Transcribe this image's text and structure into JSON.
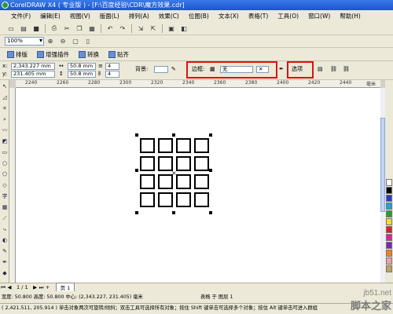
{
  "window": {
    "title": "CorelDRAW X4 ( 专业版 ) - [F:\\百度经验\\CDR\\魔方效果.cdr]"
  },
  "menu": [
    "文件(F)",
    "编辑(E)",
    "视图(V)",
    "版面(L)",
    "排列(A)",
    "效果(C)",
    "位图(B)",
    "文本(X)",
    "表格(T)",
    "工具(O)",
    "窗口(W)",
    "帮助(H)"
  ],
  "toolbar": {
    "zoom": "100%",
    "tabs": [
      "排版",
      "增强插件",
      "转换",
      "贴齐"
    ]
  },
  "propbar": {
    "x_value": "2,343.227 mm",
    "y_value": "231.405 mm",
    "width_value": "50.8 mm",
    "height_value": "50.8 mm",
    "rows": "4",
    "cols": "4",
    "bg_label": "背景:",
    "border_label": "边框:",
    "border_value": "无",
    "options_label": "选项"
  },
  "ruler": {
    "labels": [
      "2240",
      "2260",
      "2280",
      "2300",
      "2320",
      "2340",
      "2360",
      "2380",
      "2400",
      "2420",
      "2440",
      "毫米"
    ]
  },
  "pagebar": {
    "page_count": "1 / 1",
    "page_tab": "页 1"
  },
  "status": {
    "line1": "宽度: 50.800  高度: 50.800  中心: (2,343.227, 231.405)  毫米",
    "line1_right": "表格 于 图层 1",
    "line2": "( 2,421.511, 205.914 )  单击对象两次可旋转/倾斜；双击工具可选择所有对象；按住 Shift 键单击可选择多个对象；按住 Alt 键单击可进入群组"
  },
  "watermark": {
    "site": "jb51.net",
    "name": "脚本之家"
  },
  "colors": {
    "highlight": "#e01010",
    "title_bar": "#1c54d0"
  },
  "icons": [
    "pick-tool-icon",
    "shape-tool-icon",
    "zoom-tool-icon",
    "freehand-tool-icon",
    "rectangle-tool-icon",
    "ellipse-tool-icon",
    "polygon-tool-icon",
    "text-tool-icon",
    "table-tool-icon",
    "fill-tool-icon"
  ]
}
